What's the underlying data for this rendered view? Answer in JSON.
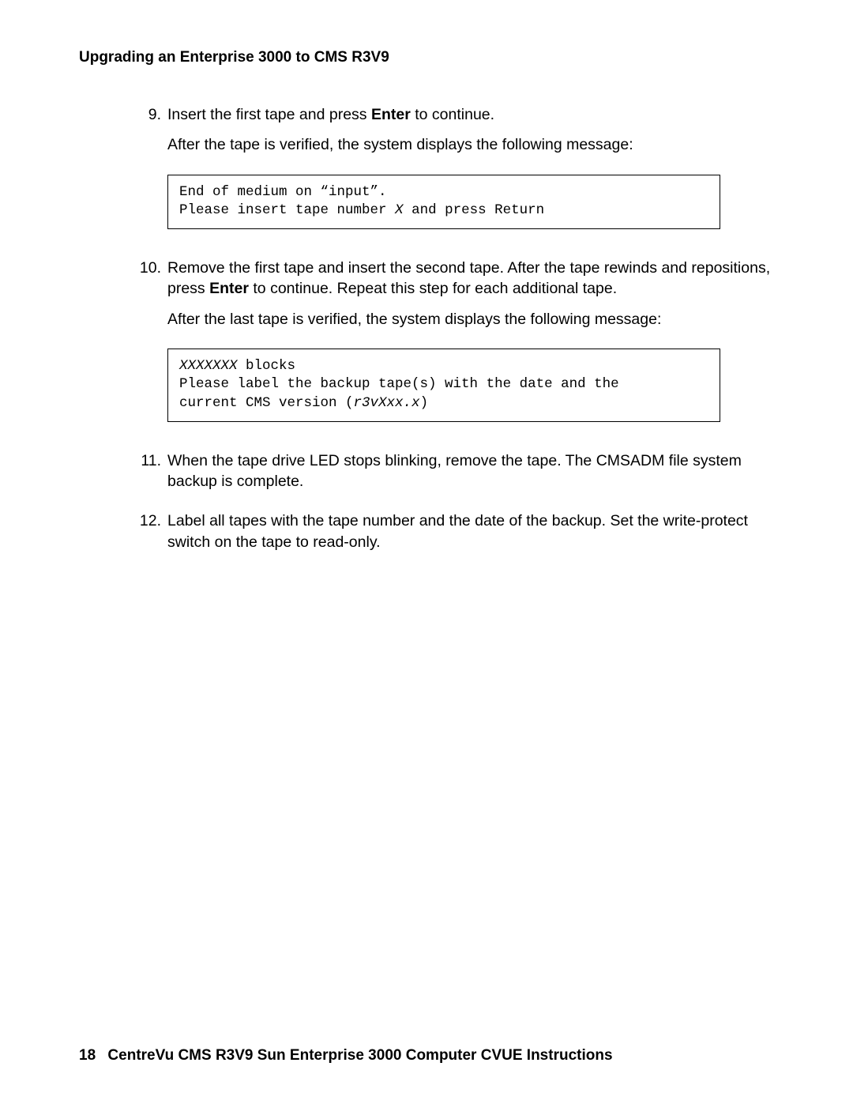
{
  "header": {
    "title": "Upgrading an Enterprise 3000 to CMS R3V9"
  },
  "steps": {
    "s9": {
      "number": "9.",
      "text_a": "Insert the first tape and press ",
      "enter": "Enter",
      "text_b": " to continue.",
      "para2": "After the tape is verified, the system displays the following message:",
      "code_line1": "End of medium on “input”.",
      "code_line2a": "Please insert tape number ",
      "code_line2_italic": "X",
      "code_line2b": " and press Return"
    },
    "s10": {
      "number": "10.",
      "text_a": "Remove the first tape and insert the second tape. After the tape rewinds and repositions, press ",
      "enter": "Enter",
      "text_b": " to continue. Repeat this step for each additional tape.",
      "para2": "After the last tape is verified, the system displays the following message:",
      "code_line1_italic": "XXXXXXX",
      "code_line1b": " blocks",
      "code_line2": "Please label the backup tape(s) with the date and the",
      "code_line3a": "current CMS version (",
      "code_line3_italic": "r3vXxx.x",
      "code_line3b": ")"
    },
    "s11": {
      "number": "11.",
      "text": "When the tape drive LED stops blinking, remove the tape. The CMSADM file system backup is complete."
    },
    "s12": {
      "number": "12.",
      "text": "Label all tapes with the tape number and the date of the backup. Set the write-protect switch on the tape to read-only."
    }
  },
  "footer": {
    "page": "18",
    "text": "CentreVu CMS R3V9 Sun Enterprise 3000 Computer CVUE Instructions"
  }
}
